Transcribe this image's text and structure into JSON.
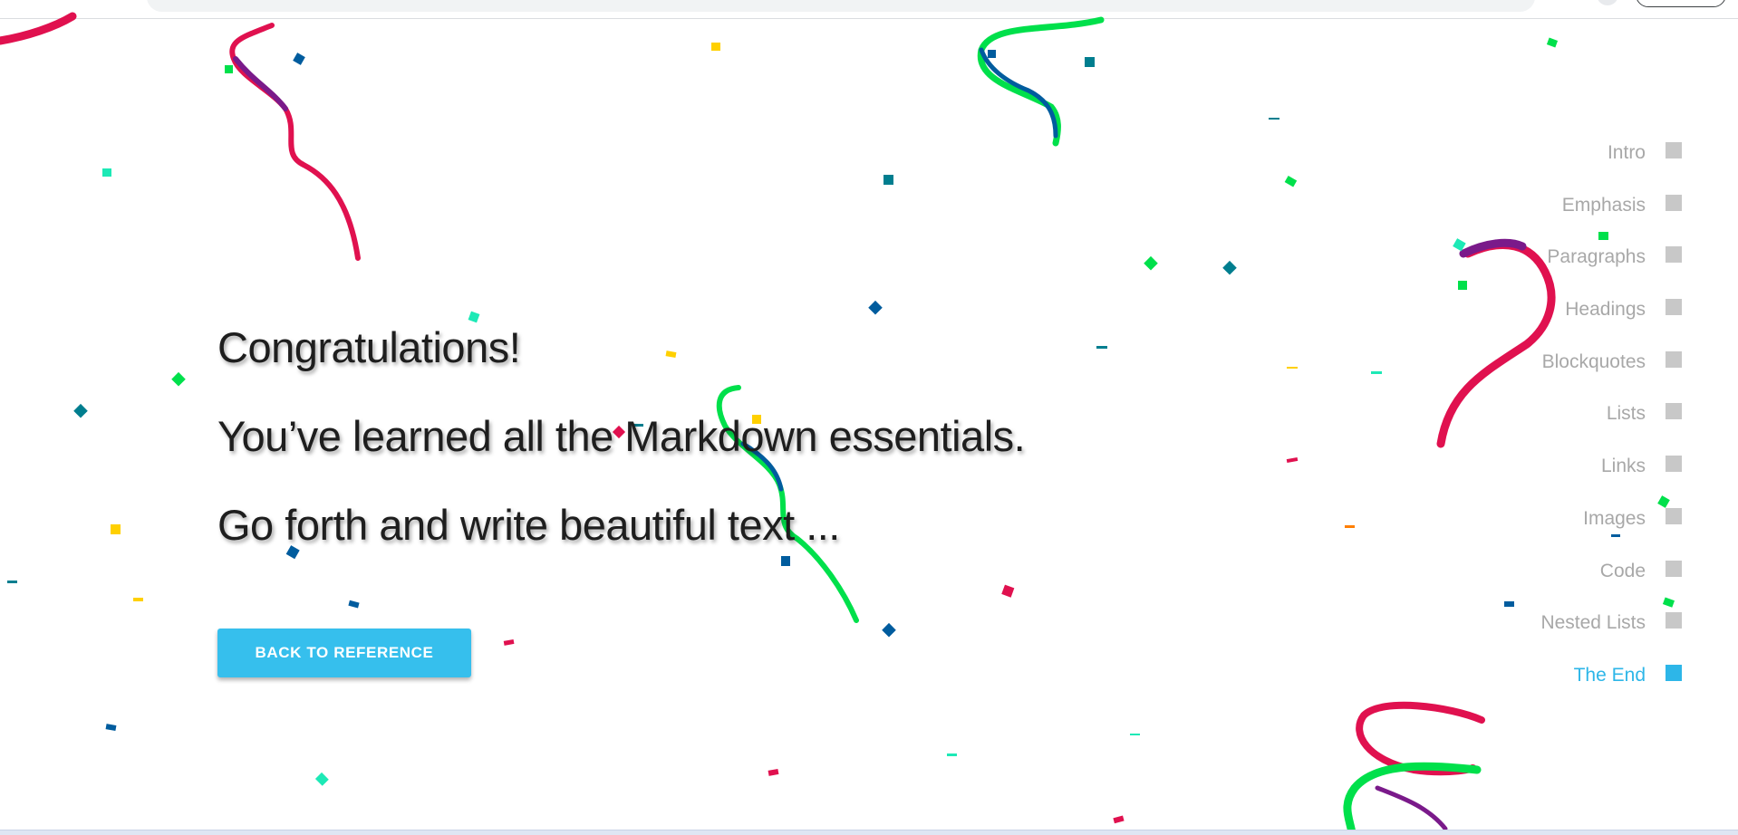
{
  "main": {
    "line1": "Congratulations!",
    "line2": "You’ve learned all the Markdown essentials.",
    "line3": "Go forth and write beautiful text ...",
    "button_label": "BACK TO REFERENCE"
  },
  "nav": {
    "items": [
      {
        "label": "Intro",
        "active": false
      },
      {
        "label": "Emphasis",
        "active": false
      },
      {
        "label": "Paragraphs",
        "active": false
      },
      {
        "label": "Headings",
        "active": false
      },
      {
        "label": "Blockquotes",
        "active": false
      },
      {
        "label": "Lists",
        "active": false
      },
      {
        "label": "Links",
        "active": false
      },
      {
        "label": "Images",
        "active": false
      },
      {
        "label": "Code",
        "active": false
      },
      {
        "label": "Nested Lists",
        "active": false
      },
      {
        "label": "The End",
        "active": true
      }
    ]
  },
  "colors": {
    "accent": "#36bfed",
    "nav_active": "#2db6e8",
    "nav_inactive": "#a8a8a8",
    "confetti": [
      "#e0114f",
      "#00e04b",
      "#005c9e",
      "#007e8f",
      "#ffd000",
      "#1de9b6",
      "#7a1a8a",
      "#ff7f00"
    ]
  }
}
